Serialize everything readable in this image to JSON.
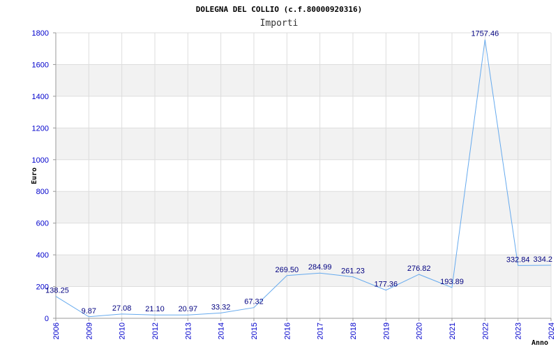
{
  "chart_data": {
    "type": "line",
    "title": "DOLEGNA DEL COLLIO (c.f.80000920316)",
    "subtitle": "Importi",
    "xlabel": "Anno",
    "ylabel": "Euro",
    "ylim": [
      0,
      1800
    ],
    "yticks": [
      "0",
      "200",
      "400",
      "600",
      "800",
      "1000",
      "1200",
      "1400",
      "1600",
      "1800"
    ],
    "grid": true,
    "categories": [
      "2006",
      "2009",
      "2010",
      "2012",
      "2013",
      "2014",
      "2015",
      "2016",
      "2017",
      "2018",
      "2019",
      "2020",
      "2021",
      "2022",
      "2023",
      "2024"
    ],
    "values": [
      138.25,
      9.87,
      27.08,
      21.1,
      20.97,
      33.32,
      67.32,
      269.5,
      284.99,
      261.23,
      177.36,
      276.82,
      193.89,
      1757.46,
      332.84,
      334.2
    ],
    "data_labels": [
      "138.25",
      "9.87",
      "27.08",
      "21.10",
      "20.97",
      "33.32",
      "67.32",
      "269.50",
      "284.99",
      "261.23",
      "177.36",
      "276.82",
      "193.89",
      "1757.46",
      "332.84",
      "334.2"
    ],
    "colors": {
      "line": "#66aaee",
      "band": "#f2f2f2",
      "grid": "#dddddd",
      "axis": "#999999",
      "tick_text": "#0000cc",
      "data_label": "#000080"
    }
  }
}
